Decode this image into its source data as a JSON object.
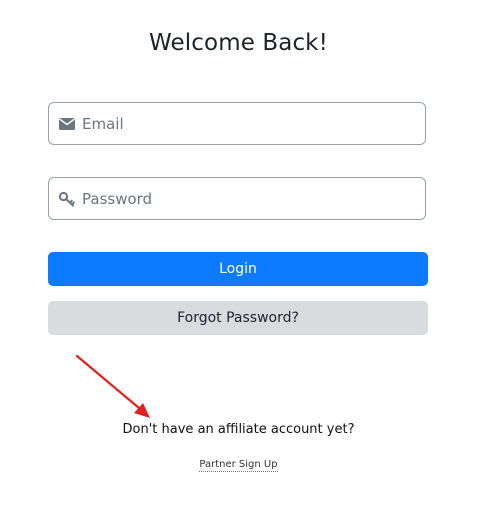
{
  "page": {
    "title": "Welcome Back!"
  },
  "form": {
    "email": {
      "placeholder": "Email",
      "value": "",
      "icon": "envelope-icon"
    },
    "password": {
      "placeholder": "Password",
      "value": "",
      "icon": "key-icon"
    },
    "login_label": "Login",
    "forgot_label": "Forgot Password?"
  },
  "signup": {
    "prompt": "Don't have an affiliate account yet?",
    "link_label": "Partner Sign Up"
  },
  "colors": {
    "primary": "#0d7bff",
    "secondary": "#d8dcdf",
    "annotation_arrow": "#e02020",
    "icon": "#6c757d"
  }
}
